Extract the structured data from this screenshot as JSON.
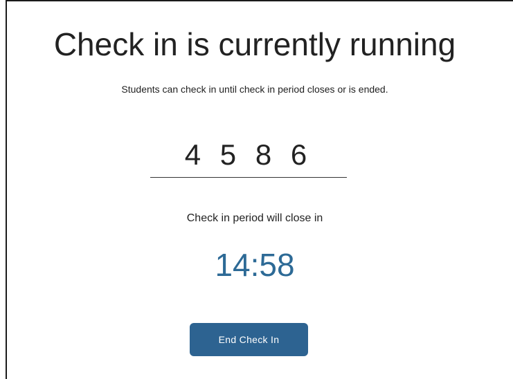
{
  "header": {
    "title": "Check in is currently running",
    "subtitle": "Students can check in until check in period closes or is ended."
  },
  "checkin": {
    "code": "4 5 8 6",
    "close_label": "Check in period will close in",
    "timer": "14:58",
    "end_button_label": "End Check In"
  },
  "colors": {
    "accent": "#2d6391",
    "timer": "#2d6a96",
    "text": "#222222",
    "background": "#ffffff"
  }
}
